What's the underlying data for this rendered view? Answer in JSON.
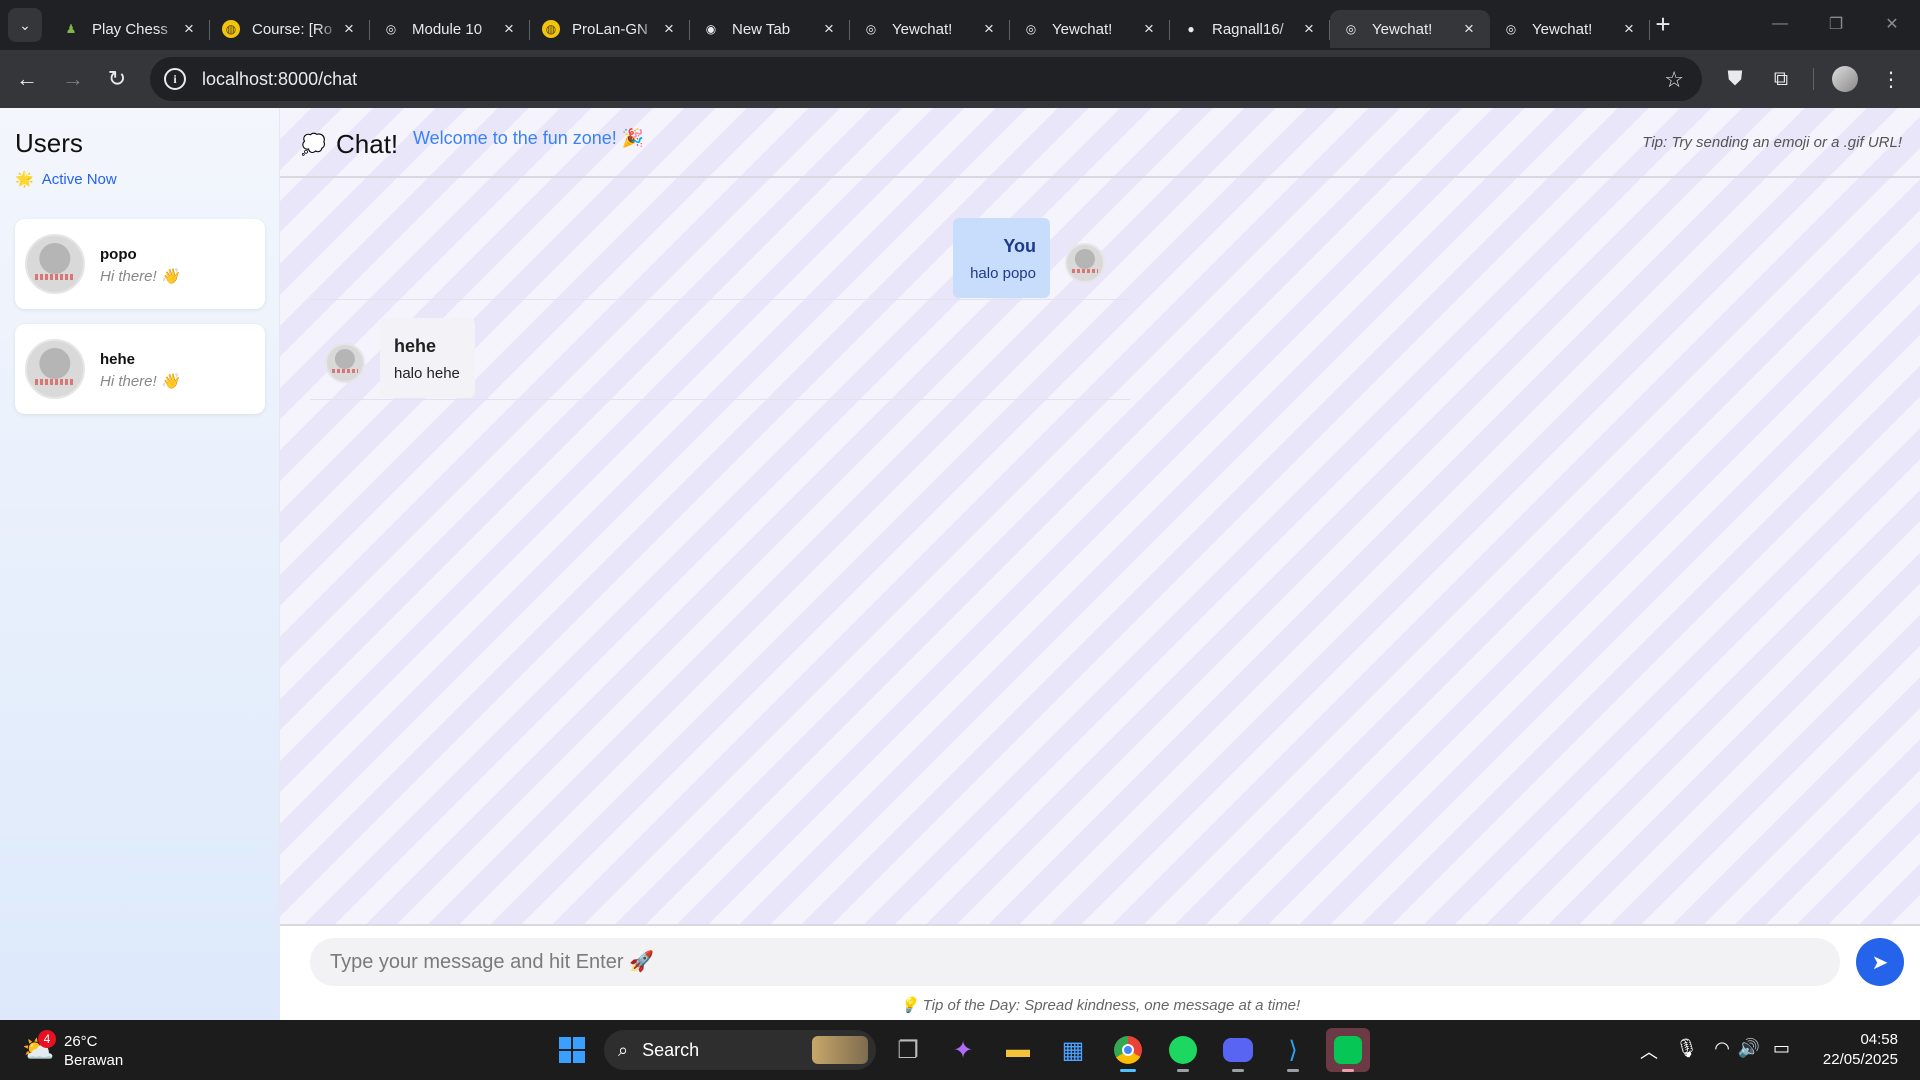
{
  "browser": {
    "tabs": [
      {
        "title": "Play Chess",
        "icon": "chess-pawn-icon",
        "glyph": "♟",
        "fav_bg": "transparent",
        "fav_color": "#81b64c"
      },
      {
        "title": "Course: [Ro",
        "icon": "moodle-icon",
        "glyph": "◍",
        "fav_bg": "#f1c40f",
        "fav_color": "#5a4300"
      },
      {
        "title": "Module 10",
        "icon": "globe-icon",
        "glyph": "◎",
        "fav_bg": "transparent",
        "fav_color": "#e8eaed"
      },
      {
        "title": "ProLan-GN",
        "icon": "moodle-icon",
        "glyph": "◍",
        "fav_bg": "#f1c40f",
        "fav_color": "#5a4300"
      },
      {
        "title": "New Tab",
        "icon": "chrome-icon",
        "glyph": "◉",
        "fav_bg": "transparent",
        "fav_color": "#e8eaed"
      },
      {
        "title": "Yewchat!",
        "icon": "globe-icon",
        "glyph": "◎",
        "fav_bg": "transparent",
        "fav_color": "#e8eaed"
      },
      {
        "title": "Yewchat!",
        "icon": "globe-icon",
        "glyph": "◎",
        "fav_bg": "transparent",
        "fav_color": "#e8eaed"
      },
      {
        "title": "Ragnall16/",
        "icon": "github-icon",
        "glyph": "●",
        "fav_bg": "transparent",
        "fav_color": "#e8eaed"
      },
      {
        "title": "Yewchat!",
        "icon": "globe-icon",
        "glyph": "◎",
        "fav_bg": "transparent",
        "fav_color": "#e8eaed",
        "active": true
      },
      {
        "title": "Yewchat!",
        "icon": "globe-icon",
        "glyph": "◎",
        "fav_bg": "transparent",
        "fav_color": "#e8eaed"
      }
    ],
    "url": "localhost:8000/chat"
  },
  "sidebar": {
    "title": "Users",
    "status": "Active Now",
    "users": [
      {
        "name": "popo",
        "message": "Hi there! 👋"
      },
      {
        "name": "hehe",
        "message": "Hi there! 👋"
      }
    ]
  },
  "chat": {
    "title": "Chat!",
    "welcome": "Welcome to the fun zone! 🎉",
    "tip": "Tip: Try sending an emoji or a .gif URL!",
    "messages": [
      {
        "sender": "You",
        "text": "halo popo",
        "mine": true
      },
      {
        "sender": "hehe",
        "text": "halo hehe",
        "mine": false
      }
    ],
    "input_placeholder": "Type your message and hit Enter 🚀",
    "tip_of_day": "💡 Tip of the Day: Spread kindness, one message at a time!"
  },
  "taskbar": {
    "weather_temp": "26°C",
    "weather_condition": "Berawan",
    "weather_badge": "4",
    "search_label": "Search",
    "time": "04:58",
    "date": "22/05/2025"
  },
  "colors": {
    "accent": "#2563eb",
    "welcome_text": "#3b82f6",
    "my_bubble": "#c8dcfb"
  }
}
